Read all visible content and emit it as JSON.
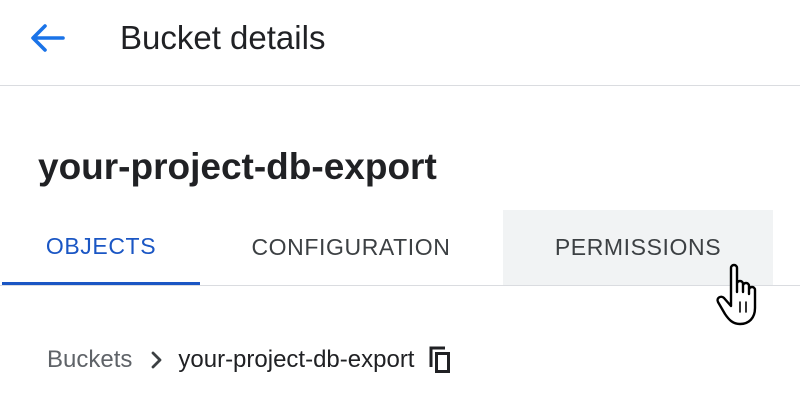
{
  "header": {
    "title": "Bucket details",
    "back_icon": "arrow-back-icon",
    "accent_color": "#1a73e8"
  },
  "bucket": {
    "name": "your-project-db-export"
  },
  "tabs": [
    {
      "label": "OBJECTS",
      "active": true
    },
    {
      "label": "CONFIGURATION",
      "active": false
    },
    {
      "label": "PERMISSIONS",
      "active": false,
      "hovered": true
    }
  ],
  "breadcrumb": {
    "root": "Buckets",
    "separator_icon": "chevron-right-icon",
    "current": "your-project-db-export",
    "copy_icon": "copy-icon"
  },
  "colors": {
    "active_tab": "#1a56c4",
    "hover_tab_bg": "#f1f3f4",
    "divider": "#dadce0"
  }
}
